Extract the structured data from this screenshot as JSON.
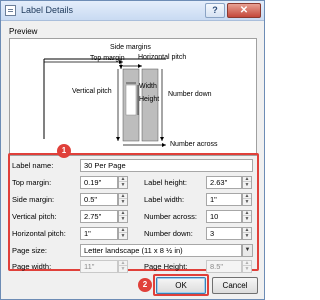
{
  "window": {
    "title": "Label Details",
    "help_label": "?",
    "close_label": "✕"
  },
  "preview": {
    "section_label": "Preview",
    "labels": {
      "side_margins": "Side margins",
      "top_margin": "Top margin",
      "horizontal_pitch": "Horizontal pitch",
      "vertical_pitch": "Vertical pitch",
      "width": "Width",
      "height": "Height",
      "number_down": "Number down",
      "number_across": "Number across"
    }
  },
  "form": {
    "label_name": {
      "label": "Label name:",
      "value": "30 Per Page"
    },
    "top_margin": {
      "label": "Top margin:",
      "value": "0.19\""
    },
    "side_margin": {
      "label": "Side margin:",
      "value": "0.5\""
    },
    "vertical_pitch": {
      "label": "Vertical pitch:",
      "value": "2.75\""
    },
    "horizontal_pitch": {
      "label": "Horizontal pitch:",
      "value": "1\""
    },
    "label_height": {
      "label": "Label height:",
      "value": "2.63\""
    },
    "label_width": {
      "label": "Label width:",
      "value": "1\""
    },
    "number_across": {
      "label": "Number across:",
      "value": "10"
    },
    "number_down": {
      "label": "Number down:",
      "value": "3"
    },
    "page_size": {
      "label": "Page size:",
      "value": "Letter landscape (11 x 8 ½ in)"
    },
    "page_width": {
      "label": "Page width:",
      "value": "11\""
    },
    "page_height": {
      "label": "Page Height:",
      "value": "8.5\""
    }
  },
  "annotations": {
    "badge_1": "1",
    "badge_2": "2",
    "highlight_color": "#e0403a"
  },
  "buttons": {
    "ok": "OK",
    "cancel": "Cancel"
  }
}
